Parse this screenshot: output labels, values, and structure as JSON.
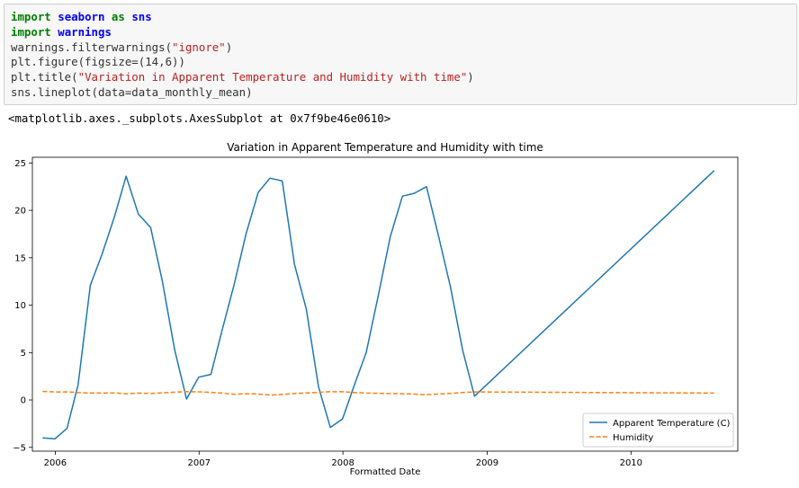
{
  "cell": {
    "code_lines": [
      [
        {
          "t": "import",
          "c": "kw"
        },
        {
          "t": " "
        },
        {
          "t": "seaborn",
          "c": "mod"
        },
        {
          "t": " "
        },
        {
          "t": "as",
          "c": "kw"
        },
        {
          "t": " "
        },
        {
          "t": "sns",
          "c": "mod"
        }
      ],
      [
        {
          "t": "import",
          "c": "kw"
        },
        {
          "t": " "
        },
        {
          "t": "warnings",
          "c": "mod"
        }
      ],
      [
        {
          "t": "warnings.filterwarnings("
        },
        {
          "t": "\"ignore\"",
          "c": "str"
        },
        {
          "t": ")"
        }
      ],
      [
        {
          "t": "plt.figure(figsize=(14,6))"
        }
      ],
      [
        {
          "t": "plt.title("
        },
        {
          "t": "\"Variation in Apparent Temperature and Humidity with time\"",
          "c": "str"
        },
        {
          "t": ")"
        }
      ],
      [
        {
          "t": "sns.lineplot(data=data_monthly_mean)"
        }
      ]
    ],
    "output": "<matplotlib.axes._subplots.AxesSubplot at 0x7f9be46e0610>"
  },
  "colors": {
    "temperature": "#1f77b4",
    "humidity": "#ff7f0e"
  },
  "chart_data": {
    "type": "line",
    "title": "Variation in Apparent Temperature and Humidity with time",
    "xlabel": "Formatted Date",
    "ylabel": "",
    "xlim": [
      "2005-11-04",
      "2010-09-29"
    ],
    "ylim": [
      -5.4,
      25.6
    ],
    "x_ticks": [
      {
        "x": "2006-01-01",
        "label": "2006"
      },
      {
        "x": "2007-01-01",
        "label": "2007"
      },
      {
        "x": "2008-01-01",
        "label": "2008"
      },
      {
        "x": "2009-01-01",
        "label": "2009"
      },
      {
        "x": "2010-01-01",
        "label": "2010"
      }
    ],
    "y_ticks": [
      {
        "y": -5,
        "label": "−5"
      },
      {
        "y": 0,
        "label": "0"
      },
      {
        "y": 5,
        "label": "5"
      },
      {
        "y": 10,
        "label": "10"
      },
      {
        "y": 15,
        "label": "15"
      },
      {
        "y": 20,
        "label": "20"
      },
      {
        "y": 25,
        "label": "25"
      }
    ],
    "grid": false,
    "legend_position": "lower-right",
    "series": [
      {
        "name": "Apparent Temperature (C)",
        "style": "solid",
        "points": [
          [
            "2005-11-30",
            -4.0
          ],
          [
            "2005-12-31",
            -4.1
          ],
          [
            "2006-01-31",
            -3.0
          ],
          [
            "2006-02-28",
            1.6
          ],
          [
            "2006-03-31",
            12.1
          ],
          [
            "2006-04-30",
            15.4
          ],
          [
            "2006-05-31",
            19.3
          ],
          [
            "2006-06-30",
            23.6
          ],
          [
            "2006-07-31",
            19.6
          ],
          [
            "2006-08-31",
            18.2
          ],
          [
            "2006-09-30",
            12.5
          ],
          [
            "2006-10-31",
            5.3
          ],
          [
            "2006-11-30",
            0.1
          ],
          [
            "2006-12-31",
            2.4
          ],
          [
            "2007-01-31",
            2.7
          ],
          [
            "2007-02-28",
            7.3
          ],
          [
            "2007-03-31",
            12.2
          ],
          [
            "2007-04-30",
            17.5
          ],
          [
            "2007-05-31",
            21.9
          ],
          [
            "2007-06-30",
            23.4
          ],
          [
            "2007-07-31",
            23.1
          ],
          [
            "2007-08-31",
            14.3
          ],
          [
            "2007-09-30",
            9.6
          ],
          [
            "2007-10-31",
            1.4
          ],
          [
            "2007-11-30",
            -2.9
          ],
          [
            "2007-12-31",
            -2.0
          ],
          [
            "2008-01-31",
            1.7
          ],
          [
            "2008-02-29",
            5.0
          ],
          [
            "2008-03-31",
            11.1
          ],
          [
            "2008-04-30",
            17.2
          ],
          [
            "2008-05-31",
            21.5
          ],
          [
            "2008-06-30",
            21.8
          ],
          [
            "2008-07-31",
            22.5
          ],
          [
            "2008-08-31",
            17.2
          ],
          [
            "2008-09-30",
            11.9
          ],
          [
            "2008-10-31",
            5.2
          ],
          [
            "2008-11-30",
            0.4
          ],
          [
            "2010-07-31",
            24.2
          ]
        ]
      },
      {
        "name": "Humidity",
        "style": "dashed",
        "points": [
          [
            "2005-11-30",
            0.9
          ],
          [
            "2005-12-31",
            0.85
          ],
          [
            "2006-01-31",
            0.85
          ],
          [
            "2006-02-28",
            0.78
          ],
          [
            "2006-03-31",
            0.74
          ],
          [
            "2006-04-30",
            0.72
          ],
          [
            "2006-05-31",
            0.74
          ],
          [
            "2006-06-30",
            0.65
          ],
          [
            "2006-07-31",
            0.72
          ],
          [
            "2006-08-31",
            0.68
          ],
          [
            "2006-09-30",
            0.75
          ],
          [
            "2006-10-31",
            0.82
          ],
          [
            "2006-11-30",
            0.88
          ],
          [
            "2006-12-31",
            0.86
          ],
          [
            "2007-01-31",
            0.8
          ],
          [
            "2007-02-28",
            0.72
          ],
          [
            "2007-03-31",
            0.6
          ],
          [
            "2007-04-30",
            0.66
          ],
          [
            "2007-05-31",
            0.62
          ],
          [
            "2007-06-30",
            0.52
          ],
          [
            "2007-07-31",
            0.58
          ],
          [
            "2007-08-31",
            0.68
          ],
          [
            "2007-09-30",
            0.74
          ],
          [
            "2007-10-31",
            0.8
          ],
          [
            "2007-11-30",
            0.88
          ],
          [
            "2007-12-31",
            0.87
          ],
          [
            "2008-01-31",
            0.78
          ],
          [
            "2008-02-29",
            0.72
          ],
          [
            "2008-03-31",
            0.7
          ],
          [
            "2008-04-30",
            0.68
          ],
          [
            "2008-05-31",
            0.66
          ],
          [
            "2008-06-30",
            0.62
          ],
          [
            "2008-07-31",
            0.55
          ],
          [
            "2008-08-31",
            0.62
          ],
          [
            "2008-09-30",
            0.7
          ],
          [
            "2008-10-31",
            0.78
          ],
          [
            "2008-11-30",
            0.85
          ],
          [
            "2010-07-31",
            0.72
          ]
        ]
      }
    ]
  }
}
